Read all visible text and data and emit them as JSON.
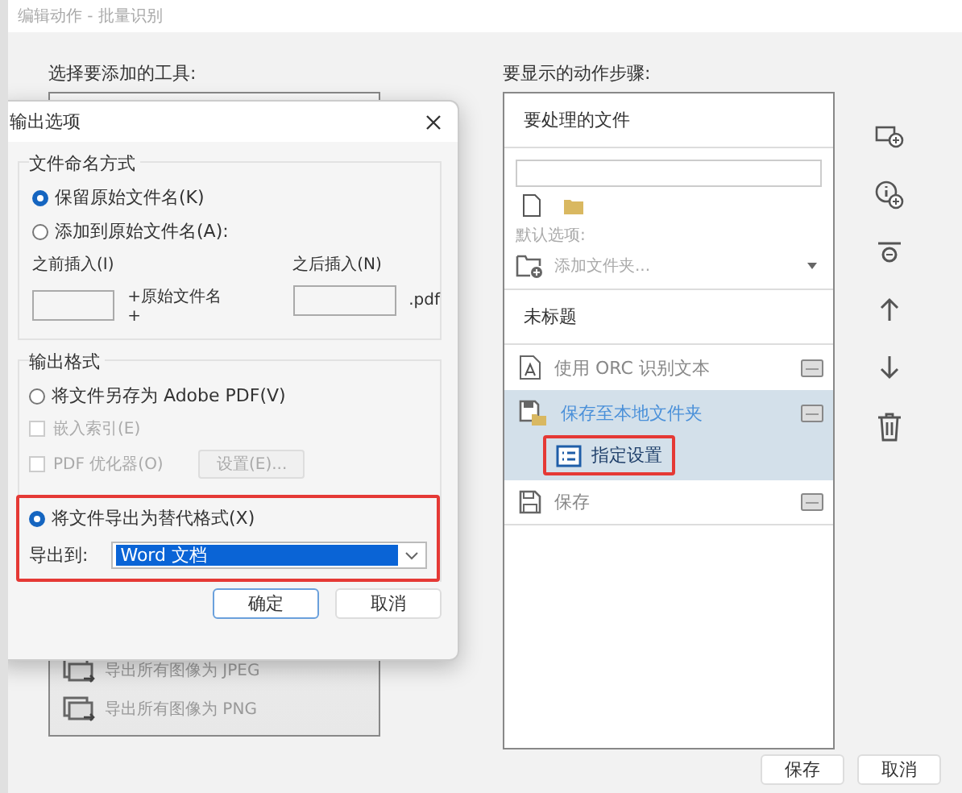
{
  "window": {
    "title": "编辑动作 - 批量识别"
  },
  "tools": {
    "label": "选择要添加的工具:",
    "items": [
      {
        "label": "导出所有图像为 JPEG"
      },
      {
        "label": "导出所有图像为 PNG"
      }
    ]
  },
  "steps": {
    "label": "要显示的动作步骤:",
    "files_header": "要处理的文件",
    "default_label": "默认选项:",
    "add_folder": "添加文件夹...",
    "section_title": "未标题",
    "items": [
      {
        "kind": "ocr",
        "label": "使用 ORC 识别文本",
        "selected": false
      },
      {
        "kind": "save-folder",
        "label": "保存至本地文件夹",
        "selected": true,
        "children": [
          {
            "label": "指定设置"
          }
        ]
      },
      {
        "kind": "save",
        "label": "保存",
        "selected": false
      }
    ]
  },
  "buttons": [
    {
      "label": "保存"
    },
    {
      "label": "取消"
    }
  ],
  "dialog": {
    "title": "输出选项",
    "naming": {
      "legend": "文件命名方式",
      "options": [
        {
          "label": "保留原始文件名(K)",
          "selected": true
        },
        {
          "label": "添加到原始文件名(A):",
          "selected": false
        }
      ],
      "before_label": "之前插入(I)",
      "after_label": "之后插入(N)",
      "middle": "+原始文件名+",
      "ext": ".pdf"
    },
    "format": {
      "legend": "输出格式",
      "radios": [
        {
          "label": "将文件另存为 Adobe PDF(V)",
          "selected": false
        },
        {
          "label": "将文件导出为替代格式(X)",
          "selected": true
        }
      ],
      "checkboxes": [
        {
          "label": "嵌入索引(E)",
          "checked": false,
          "disabled": true
        },
        {
          "label": "PDF 优化器(O)",
          "checked": false,
          "disabled": true
        }
      ],
      "settings_button": {
        "label": "设置(E)...",
        "disabled": true
      },
      "export_to_label": "导出到:",
      "export_value": "Word 文档"
    },
    "buttons": [
      {
        "label": "确定",
        "default": true
      },
      {
        "label": "取消",
        "default": false
      }
    ]
  }
}
